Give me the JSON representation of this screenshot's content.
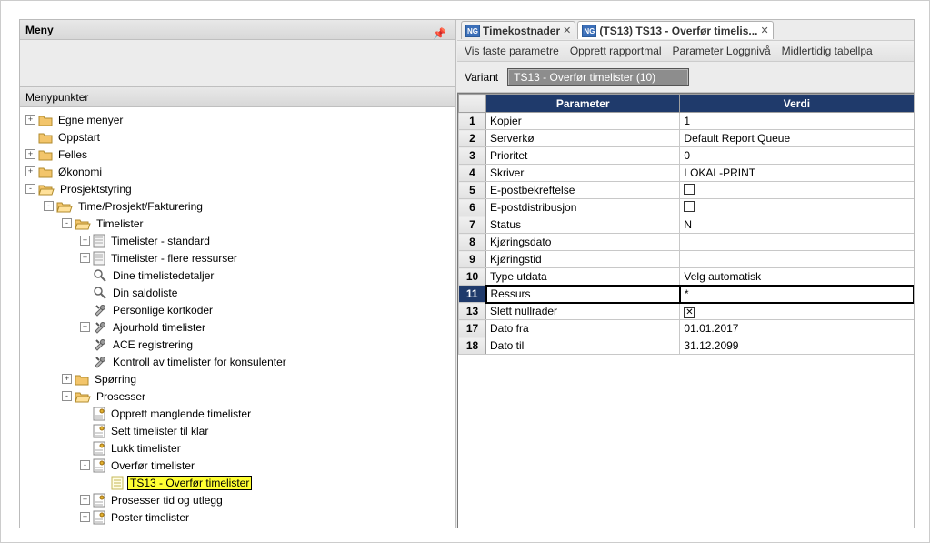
{
  "panel": {
    "title": "Meny",
    "subheader": "Menypunkter"
  },
  "tree": [
    {
      "level": 0,
      "toggle": "+",
      "icon": "folder-closed",
      "label": "Egne menyer"
    },
    {
      "level": 0,
      "toggle": "",
      "icon": "folder-closed",
      "label": "Oppstart"
    },
    {
      "level": 0,
      "toggle": "+",
      "icon": "folder-closed",
      "label": "Felles"
    },
    {
      "level": 0,
      "toggle": "+",
      "icon": "folder-closed",
      "label": "Økonomi"
    },
    {
      "level": 0,
      "toggle": "-",
      "icon": "folder-open",
      "label": "Prosjektstyring"
    },
    {
      "level": 1,
      "toggle": "-",
      "icon": "folder-open",
      "label": "Time/Prosjekt/Fakturering"
    },
    {
      "level": 2,
      "toggle": "-",
      "icon": "folder-open",
      "label": "Timelister"
    },
    {
      "level": 3,
      "toggle": "+",
      "icon": "doc",
      "label": "Timelister - standard"
    },
    {
      "level": 3,
      "toggle": "+",
      "icon": "doc",
      "label": "Timelister - flere ressurser"
    },
    {
      "level": 3,
      "toggle": "",
      "icon": "mag",
      "label": "Dine timelistedetaljer"
    },
    {
      "level": 3,
      "toggle": "",
      "icon": "mag",
      "label": "Din saldoliste"
    },
    {
      "level": 3,
      "toggle": "",
      "icon": "tool",
      "label": "Personlige kortkoder"
    },
    {
      "level": 3,
      "toggle": "+",
      "icon": "tool",
      "label": "Ajourhold timelister"
    },
    {
      "level": 3,
      "toggle": "",
      "icon": "tool",
      "label": "ACE registrering"
    },
    {
      "level": 3,
      "toggle": "",
      "icon": "tool",
      "label": "Kontroll av timelister for konsulenter"
    },
    {
      "level": 2,
      "toggle": "+",
      "icon": "folder-closed",
      "label": "Spørring"
    },
    {
      "level": 2,
      "toggle": "-",
      "icon": "folder-open",
      "label": "Prosesser"
    },
    {
      "level": 3,
      "toggle": "",
      "icon": "report",
      "label": "Opprett manglende timelister"
    },
    {
      "level": 3,
      "toggle": "",
      "icon": "report",
      "label": "Sett timelister til klar"
    },
    {
      "level": 3,
      "toggle": "",
      "icon": "report",
      "label": "Lukk timelister"
    },
    {
      "level": 3,
      "toggle": "-",
      "icon": "report",
      "label": "Overfør timelister"
    },
    {
      "level": 4,
      "toggle": "",
      "icon": "sheet",
      "label": "TS13 - Overfør timelister",
      "highlight": true
    },
    {
      "level": 3,
      "toggle": "+",
      "icon": "report",
      "label": "Prosesser tid og utlegg"
    },
    {
      "level": 3,
      "toggle": "+",
      "icon": "report",
      "label": "Poster timelister"
    }
  ],
  "tabs": [
    {
      "label": "Timekostnader",
      "active": false
    },
    {
      "label": "(TS13) TS13 - Overfør timelis...",
      "active": true
    }
  ],
  "toolbar": {
    "item1": "Vis faste parametre",
    "item2": "Opprett rapportmal",
    "item3": "Parameter Loggnivå",
    "item4": "Midlertidig tabellpa"
  },
  "variant": {
    "label": "Variant",
    "value": "TS13 - Overfør timelister     (10)"
  },
  "grid": {
    "col1": "Parameter",
    "col2": "Verdi",
    "rows": [
      {
        "n": "1",
        "name": "Kopier",
        "value": "1",
        "type": "text"
      },
      {
        "n": "2",
        "name": "Serverkø",
        "value": "Default Report Queue",
        "type": "text"
      },
      {
        "n": "3",
        "name": "Prioritet",
        "value": "0",
        "type": "text"
      },
      {
        "n": "4",
        "name": "Skriver",
        "value": "LOKAL-PRINT",
        "type": "text"
      },
      {
        "n": "5",
        "name": "E-postbekreftelse",
        "value": "",
        "type": "checkbox",
        "checked": false
      },
      {
        "n": "6",
        "name": "E-postdistribusjon",
        "value": "",
        "type": "checkbox",
        "checked": false
      },
      {
        "n": "7",
        "name": "Status",
        "value": "N",
        "type": "text"
      },
      {
        "n": "8",
        "name": "Kjøringsdato",
        "value": "",
        "type": "text"
      },
      {
        "n": "9",
        "name": "Kjøringstid",
        "value": "",
        "type": "text"
      },
      {
        "n": "10",
        "name": "Type utdata",
        "value": "Velg automatisk",
        "type": "text"
      },
      {
        "n": "11",
        "name": "Ressurs",
        "value": "*",
        "type": "text",
        "selected": true
      },
      {
        "n": "13",
        "name": "Slett nullrader",
        "value": "",
        "type": "checkbox",
        "checked": true
      },
      {
        "n": "17",
        "name": "Dato fra",
        "value": "01.01.2017",
        "type": "text"
      },
      {
        "n": "18",
        "name": "Dato til",
        "value": "31.12.2099",
        "type": "text"
      }
    ]
  },
  "icons": {
    "ng": "NG"
  }
}
